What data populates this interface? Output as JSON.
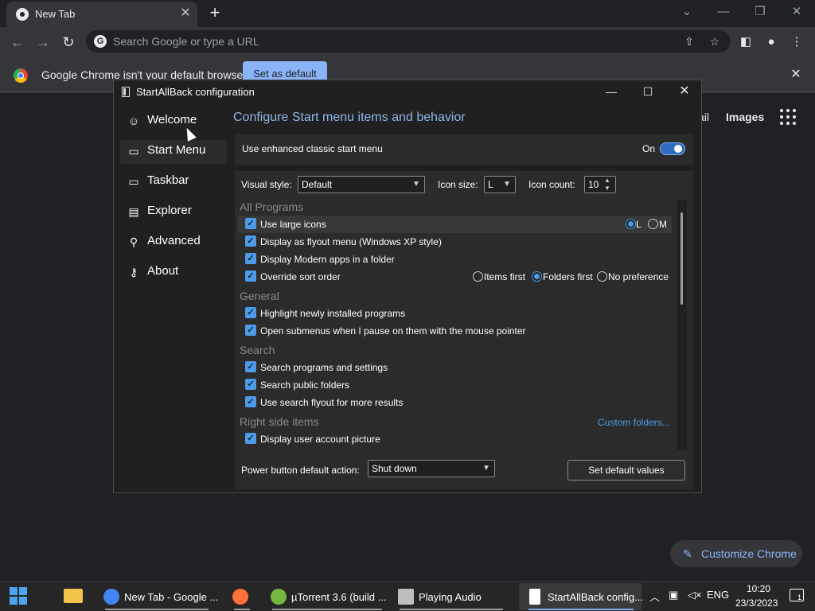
{
  "chrome": {
    "tab_title": "New Tab",
    "tab_close": "✕",
    "new_tab": "+",
    "win_minimize": "—",
    "win_restore": "❐",
    "win_close": "✕",
    "win_tabsearch": "⌄",
    "omnibox_placeholder": "Search Google or type a URL",
    "infobar_text": "Google Chrome isn't your default browser",
    "set_default_label": "Set as default",
    "infobar_close": "✕",
    "gmail": "ail",
    "images": "Images",
    "customize_label": "Customize Chrome",
    "icons": {
      "back": "back-arrow-icon",
      "forward": "forward-arrow-icon",
      "reload": "reload-icon",
      "share": "share-icon",
      "bookmark": "star-icon",
      "sidepanel": "side-panel-icon",
      "profile": "profile-icon",
      "menu": "kebab-menu-icon"
    }
  },
  "dialog": {
    "title": "StartAllBack configuration",
    "nav": [
      {
        "label": "Welcome",
        "icon": "smile-icon"
      },
      {
        "label": "Start Menu",
        "icon": "start-menu-icon"
      },
      {
        "label": "Taskbar",
        "icon": "taskbar-icon"
      },
      {
        "label": "Explorer",
        "icon": "folder-icon"
      },
      {
        "label": "Advanced",
        "icon": "wrench-icon"
      },
      {
        "label": "About",
        "icon": "key-icon"
      }
    ],
    "selected_nav": "Start Menu",
    "heading": "Configure Start menu items and behavior",
    "enhanced_label": "Use enhanced classic start menu",
    "enhanced_state": "On",
    "visual_style_label": "Visual style:",
    "visual_style_value": "Default",
    "icon_size_label": "Icon size:",
    "icon_size_value": "L",
    "icon_count_label": "Icon count:",
    "icon_count_value": "10",
    "groups": {
      "all_programs": "All Programs",
      "general": "General",
      "search": "Search",
      "right_side": "Right side items"
    },
    "options": {
      "large_icons": "Use large icons",
      "flyout": "Display as flyout menu (Windows XP style)",
      "modern_apps": "Display Modern apps in a folder",
      "sort_order": "Override sort order",
      "highlight_new": "Highlight newly installed programs",
      "open_submenus": "Open submenus when I pause on them with the mouse pointer",
      "search_programs": "Search programs and settings",
      "search_public": "Search public folders",
      "search_flyout": "Use search flyout for more results",
      "user_picture": "Display user account picture"
    },
    "icon_size_radio": {
      "l": "L",
      "m": "M",
      "selected": "L"
    },
    "sort_radio": {
      "items_first": "Items first",
      "folders_first": "Folders first",
      "no_pref": "No preference",
      "selected": "Folders first"
    },
    "custom_folders": "Custom folders...",
    "power_label": "Power button default action:",
    "power_value": "Shut down",
    "set_defaults": "Set default values"
  },
  "taskbar": {
    "items": [
      {
        "label": "New Tab - Google ...",
        "icon": "chrome-icon",
        "color": "#4285f4"
      },
      {
        "label": "",
        "icon": "firefox-icon",
        "color": "#ff7139"
      },
      {
        "label": "µTorrent 3.6  (build ...",
        "icon": "utorrent-icon",
        "color": "#76b83f"
      },
      {
        "label": "Playing Audio",
        "icon": "media-player-icon",
        "color": "#bdbdbd"
      },
      {
        "label": "StartAllBack config...",
        "icon": "startallback-icon",
        "color": "#ffffff"
      }
    ],
    "tray_lang": "ENG",
    "clock_time": "10:20",
    "clock_date": "23/3/2023",
    "notification_count": "1"
  }
}
